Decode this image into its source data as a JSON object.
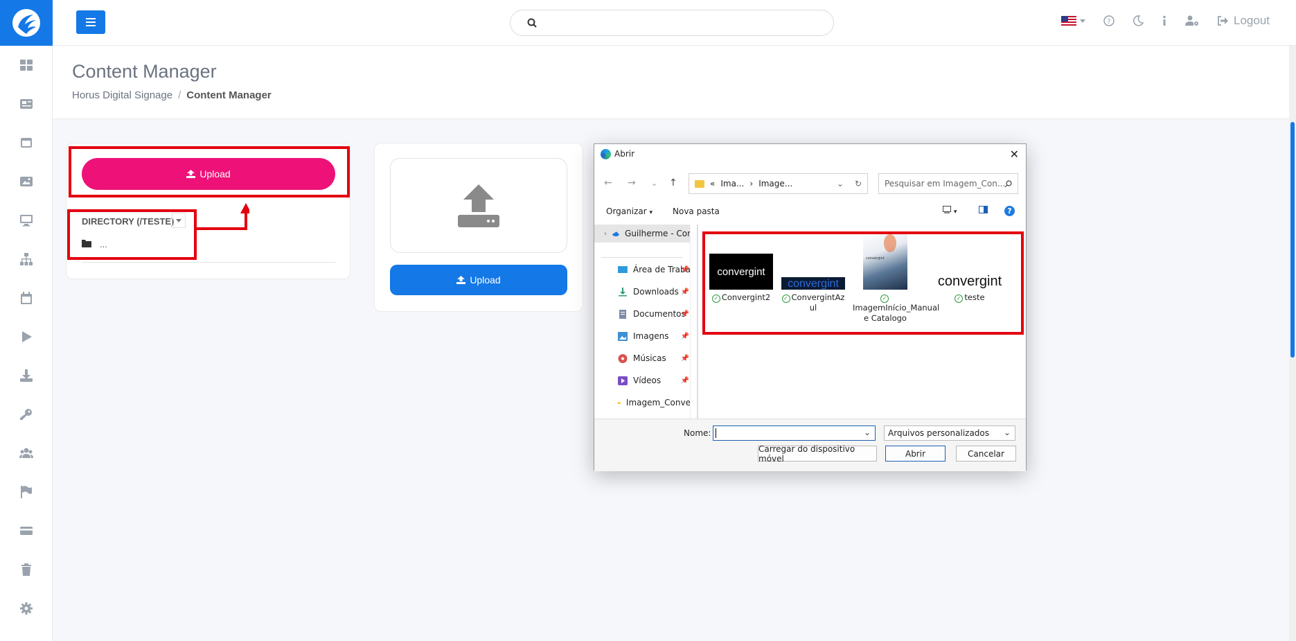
{
  "topbar": {
    "search_placeholder": "",
    "logout_label": "Logout"
  },
  "sidebar": {
    "icons": [
      "dashboard-icon",
      "newspaper-icon",
      "window-icon",
      "images-icon",
      "monitor-icon",
      "sitemap-icon",
      "calendar-icon",
      "play-icon",
      "download-icon",
      "key-icon",
      "users-icon",
      "flag-icon",
      "card-icon",
      "trash-icon",
      "gear-icon"
    ]
  },
  "header": {
    "title": "Content Manager",
    "breadcrumb": [
      "Horus Digital Signage",
      "Content Manager"
    ]
  },
  "panel_left": {
    "upload_label": "Upload",
    "directory_label": "DIRECTORY (/TESTE)",
    "folder_item": "..."
  },
  "panel_right": {
    "upload_label": "Upload"
  },
  "dialog": {
    "title": "Abrir",
    "address": [
      "«",
      "Ima...",
      "›",
      "Image..."
    ],
    "search_placeholder": "Pesquisar em Imagem_Con...",
    "organize_label": "Organizar",
    "new_folder_label": "Nova pasta",
    "nav_items": [
      {
        "label": "Guilherme - Cor",
        "icon": "cloud-icon"
      },
      {
        "label": "Área de Traba",
        "icon": "desktop-icon"
      },
      {
        "label": "Downloads",
        "icon": "download-icon"
      },
      {
        "label": "Documentos",
        "icon": "document-icon"
      },
      {
        "label": "Imagens",
        "icon": "images-icon"
      },
      {
        "label": "Músicas",
        "icon": "music-icon"
      },
      {
        "label": "Vídeos",
        "icon": "video-icon"
      },
      {
        "label": "Imagem_Conve",
        "icon": "folder-icon"
      }
    ],
    "files": [
      {
        "name": "Convergint2",
        "thumb_text": "convergint"
      },
      {
        "name": "ConvergintAzul",
        "thumb_text": "convergint"
      },
      {
        "name": "ImagemInício_Manual e Catalogo",
        "thumb_text": "convergint"
      },
      {
        "name": "teste",
        "thumb_text": "convergint"
      }
    ],
    "filename_label": "Nome:",
    "filename_value": "",
    "filetype_value": "Arquivos personalizados",
    "mobile_button": "Carregar do dispositivo móvel",
    "open_button": "Abrir",
    "cancel_button": "Cancelar"
  },
  "colors": {
    "primary": "#1478e6",
    "pink": "#ee1178",
    "annotation_red": "#e3000f"
  }
}
